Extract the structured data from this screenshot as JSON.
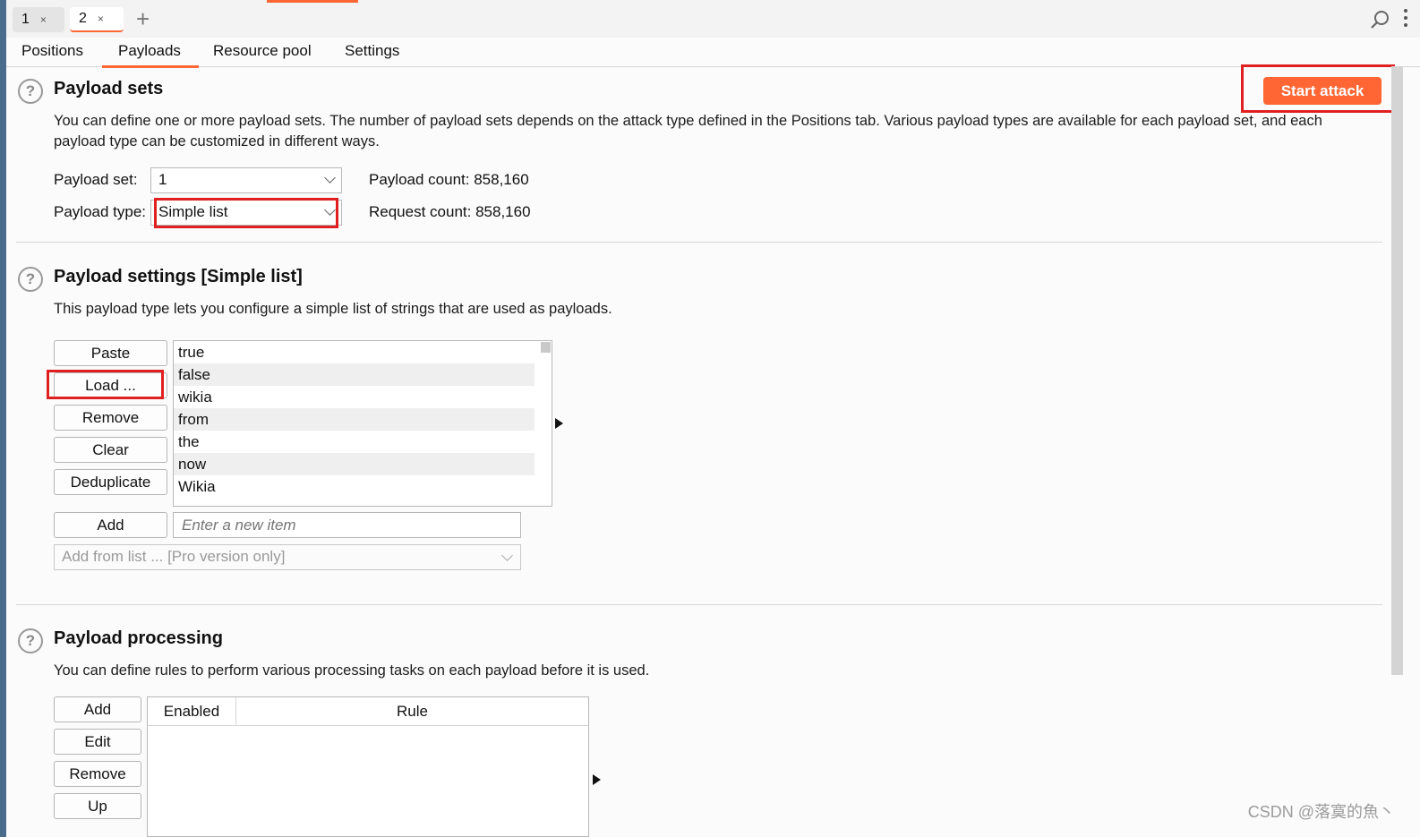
{
  "top_tabs": [
    {
      "label": "1",
      "close": "×"
    },
    {
      "label": "2",
      "close": "×"
    }
  ],
  "new_tab_label": "+",
  "sub_tabs": [
    "Positions",
    "Payloads",
    "Resource pool",
    "Settings"
  ],
  "payload_sets": {
    "title": "Payload sets",
    "description_line1": "You can define one or more payload sets. The number of payload sets depends on the attack type defined in the Positions tab. Various payload types are available for each payload set, and each",
    "description_line2": "payload type can be customized in different ways.",
    "payload_set_label": "Payload set:",
    "payload_set_value": "1",
    "payload_type_label": "Payload type:",
    "payload_type_value": "Simple list",
    "payload_count_label": "Payload count:",
    "payload_count_value": "858,160",
    "request_count_label": "Request count:",
    "request_count_value": "858,160"
  },
  "start_attack_label": "Start attack",
  "payload_settings": {
    "title": "Payload settings [Simple list]",
    "description": "This payload type lets you configure a simple list of strings that are used as payloads.",
    "buttons": {
      "paste": "Paste",
      "load": "Load ...",
      "remove": "Remove",
      "clear": "Clear",
      "deduplicate": "Deduplicate",
      "add": "Add"
    },
    "items": [
      "true",
      "false",
      "wikia",
      "from",
      "the",
      "now",
      "Wikia"
    ],
    "new_item_placeholder": "Enter a new item",
    "add_from_list": "Add from list ... [Pro version only]"
  },
  "payload_processing": {
    "title": "Payload processing",
    "description": "You can define rules to perform various processing tasks on each payload before it is used.",
    "buttons": {
      "add": "Add",
      "edit": "Edit",
      "remove": "Remove",
      "up": "Up"
    },
    "columns": [
      "Enabled",
      "Rule"
    ]
  },
  "watermark": "CSDN @落寞的魚丶",
  "accent_color": "#ff6633",
  "highlight_color": "#e02020"
}
